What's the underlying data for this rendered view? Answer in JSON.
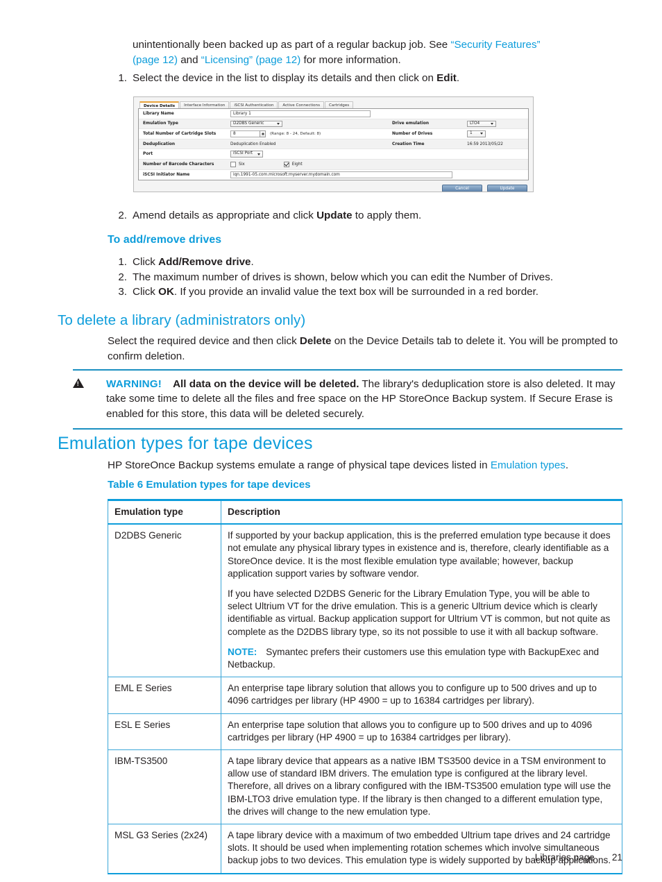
{
  "intro": {
    "line_a": "unintentionally been backed up as part of a regular backup job. See ",
    "link_1": "“Security Features” (page 12)",
    "mid": " and ",
    "link_2": "“Licensing” (page 12)",
    "line_b": " for more information."
  },
  "steps_edit": [
    {
      "num": "1.",
      "pre": "Select the device in the list to display its details and then click on ",
      "bold": "Edit",
      "post": "."
    }
  ],
  "steps_after_shot": [
    {
      "num": "2.",
      "pre": "Amend details as appropriate and click ",
      "bold": "Update",
      "post": " to apply them."
    }
  ],
  "section_add_remove": {
    "heading": "To add/remove drives",
    "steps": [
      {
        "num": "1.",
        "pre": "Click ",
        "bold": "Add/Remove drive",
        "post": "."
      },
      {
        "num": "2.",
        "pre": "The maximum number of drives is shown, below which you can edit the Number of Drives.",
        "bold": "",
        "post": ""
      },
      {
        "num": "3.",
        "pre": "Click ",
        "bold": "OK",
        "post": ". If you provide an invalid value the text box will be surrounded in a red border."
      }
    ]
  },
  "section_delete": {
    "heading": "To delete a library (administrators only)",
    "paragraph_pre": "Select the required device and then click ",
    "paragraph_bold": "Delete",
    "paragraph_post": " on the Device Details tab to delete it. You will be prompted to confirm deletion."
  },
  "warning": {
    "label": "WARNING!",
    "bold_lead": "All data on the device will be deleted.",
    "rest": " The library's deduplication store is also deleted. It may take some time to delete all the files and free space on the HP StoreOnce Backup system. If Secure Erase is enabled for this store, this data will be deleted securely.",
    "icon": "warning-triangle-icon"
  },
  "section_emulation": {
    "heading": "Emulation types for tape devices",
    "paragraph_pre": "HP StoreOnce Backup systems emulate a range of physical tape devices listed in ",
    "paragraph_link": "Emulation types",
    "paragraph_post": ".",
    "table_caption": "Table 6 Emulation types for tape devices"
  },
  "table": {
    "headers": [
      "Emulation type",
      "Description"
    ],
    "rows": [
      {
        "type": "D2DBS Generic",
        "paragraphs": [
          "If supported by your backup application, this is the preferred emulation type because it does not emulate any physical library types in existence and is, therefore, clearly identifiable as a StoreOnce device. It is the most flexible emulation type available; however, backup application support varies by software vendor.",
          "If you have selected D2DBS Generic for the Library Emulation Type, you will be able to select Ultrium VT for the drive emulation. This is a generic Ultrium device which is clearly identifiable as virtual. Backup application support for Ultrium VT is common, but not quite as complete as the D2DBS library type, so its not possible to use it with all backup software."
        ],
        "note_label": "NOTE:",
        "note_text": "Symantec prefers their customers use this emulation type with BackupExec and Netbackup."
      },
      {
        "type": "EML E Series",
        "paragraphs": [
          "An enterprise tape library solution that allows you to configure up to 500 drives and up to 4096 cartridges per library (HP 4900 = up to 16384 cartridges per library)."
        ]
      },
      {
        "type": "ESL E Series",
        "paragraphs": [
          "An enterprise tape solution that allows you to configure up to 500 drives and up to 4096 cartridges per library (HP 4900 = up to 16384 cartridges per library)."
        ]
      },
      {
        "type": "IBM-TS3500",
        "paragraphs": [
          "A tape library device that appears as a native IBM TS3500 device in a TSM environment to allow use of standard IBM drivers. The emulation type is configured at the library level. Therefore, all drives on a library configured with the IBM-TS3500 emulation type will use the IBM-LTO3 drive emulation type. If the library is then changed to a different emulation type, the drives will change to the new emulation type."
        ]
      },
      {
        "type": "MSL G3 Series (2x24)",
        "paragraphs": [
          "A tape library device with a maximum of two embedded Ultrium tape drives and 24 cartridge slots. It should be used when implementing rotation schemes which involve simultaneous backup jobs to two devices. This emulation type is widely supported by backup applications."
        ]
      }
    ]
  },
  "footer": {
    "section": "Libraries page",
    "page_number": "21"
  },
  "screenshot": {
    "tabs": [
      "Device Details",
      "Interface Information",
      "iSCSI Authentication",
      "Active Connections",
      "Cartridges"
    ],
    "active_tab": "Device Details",
    "fields": {
      "library_name_label": "Library Name",
      "library_name_value": "Library 1",
      "emulation_type_label": "Emulation Type",
      "emulation_type_value": "D2DBS Generic",
      "drive_emulation_label": "Drive emulation",
      "drive_emulation_value": "LTO4",
      "slots_label": "Total Number of Cartridge Slots",
      "slots_value": "8",
      "slots_hint": "(Range: 8 - 24, Default: 8)",
      "number_of_drives_label": "Number of Drives",
      "number_of_drives_value": "1",
      "dedup_label": "Deduplication",
      "dedup_value": "Deduplication Enabled",
      "creation_time_label": "Creation Time",
      "creation_time_value": "16:59 2013/05/22",
      "port_label": "Port",
      "port_value": "iSCSI Port",
      "barcode_label": "Number of Barcode Characters",
      "barcode_six": "Six",
      "barcode_eight": "Eight",
      "initiator_label": "iSCSI Initiator Name",
      "initiator_value": "iqn.1991-05.com.microsoft:myserver.mydomain.com"
    },
    "buttons": {
      "cancel": "Cancel",
      "update": "Update"
    }
  },
  "colors": {
    "accent_blue": "#0d9ddb",
    "table_border": "#3aa6d8",
    "text": "#231f20",
    "tab_active_marker": "#e8a33d"
  }
}
